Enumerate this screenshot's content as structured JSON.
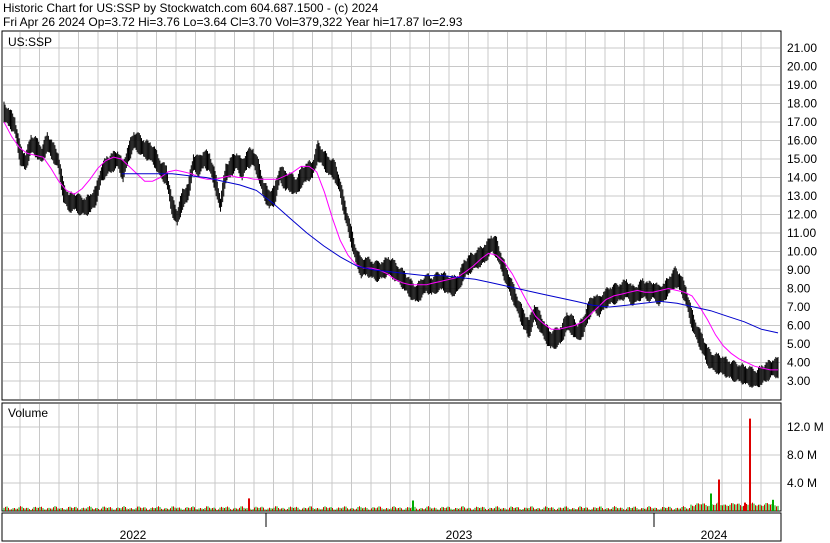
{
  "header": {
    "line1": "Historic Chart for US:SSP by Stockwatch.com 604.687.1500 - (c) 2024",
    "line2": "Fri Apr 26 2024  Op=3.72  Hi=3.76  Lo=3.64  Cl=3.70  Vol=379,322  Year hi=17.87  lo=2.93"
  },
  "chart_data": [
    {
      "type": "line",
      "title": "US:SSP",
      "ylim": [
        2.0,
        22.0
      ],
      "y_ticks": [
        "21.00",
        "20.00",
        "19.00",
        "18.00",
        "17.00",
        "16.00",
        "15.00",
        "14.00",
        "13.00",
        "12.00",
        "11.00",
        "10.00",
        "9.00",
        "8.00",
        "7.00",
        "6.00",
        "5.00",
        "4.00",
        "3.00"
      ],
      "x_labels": [
        "2022",
        "2023",
        "2024"
      ],
      "grid": true,
      "colors": {
        "price": "#000000",
        "ma_short": "#ff00ff",
        "ma_long": "#0000cc"
      },
      "series": [
        {
          "id": "price",
          "values": [
            17.5,
            17.2,
            16.8,
            15.2,
            14.8,
            15.8,
            15.6,
            15.2,
            15.9,
            15.4,
            14.9,
            13.2,
            12.6,
            12.7,
            12.5,
            12.4,
            12.6,
            13.0,
            14.2,
            14.6,
            14.8,
            15.0,
            14.3,
            15.3,
            16.0,
            15.8,
            15.5,
            15.4,
            15.0,
            14.4,
            14.1,
            12.5,
            11.8,
            12.8,
            13.2,
            14.8,
            14.6,
            15.0,
            14.8,
            13.8,
            12.5,
            14.2,
            14.6,
            14.9,
            14.4,
            15.0,
            15.1,
            14.4,
            13.3,
            12.8,
            13.0,
            14.2,
            13.8,
            13.7,
            13.5,
            14.0,
            14.3,
            14.4,
            15.4,
            15.0,
            14.6,
            14.4,
            13.6,
            12.2,
            11.0,
            9.8,
            9.1,
            9.2,
            9.0,
            8.9,
            9.0,
            9.2,
            9.0,
            8.7,
            8.4,
            8.0,
            7.7,
            7.9,
            8.3,
            8.1,
            8.3,
            8.4,
            8.2,
            8.1,
            8.3,
            9.0,
            9.3,
            9.5,
            9.7,
            9.9,
            10.4,
            10.2,
            9.3,
            8.5,
            7.8,
            7.0,
            6.3,
            5.8,
            6.7,
            6.2,
            5.6,
            5.2,
            5.3,
            5.5,
            6.2,
            6.0,
            5.6,
            5.9,
            6.8,
            7.2,
            7.0,
            7.4,
            7.6,
            7.7,
            7.8,
            8.0,
            7.6,
            7.7,
            8.0,
            7.8,
            7.9,
            7.6,
            7.8,
            8.2,
            8.6,
            8.3,
            7.6,
            6.4,
            5.6,
            5.0,
            4.3,
            4.0,
            3.9,
            3.8,
            3.6,
            3.5,
            3.4,
            3.3,
            3.2,
            3.1,
            3.3,
            3.5,
            3.7,
            3.7
          ]
        },
        {
          "id": "ma_short",
          "values": [
            17.0,
            16.2,
            15.6,
            15.3,
            15.2,
            15.1,
            14.5,
            13.8,
            13.3,
            13.1,
            13.4,
            13.9,
            14.5,
            14.9,
            15.1,
            15.0,
            14.6,
            14.2,
            13.8,
            13.8,
            14.0,
            14.3,
            14.4,
            14.3,
            14.2,
            14.0,
            13.9,
            13.9,
            14.0,
            14.1,
            14.0,
            14.0,
            13.9,
            13.9,
            13.9,
            13.9,
            14.1,
            14.3,
            14.6,
            14.6,
            14.3,
            13.2,
            11.8,
            10.6,
            9.8,
            9.3,
            9.1,
            9.1,
            9.0,
            8.8,
            8.5,
            8.3,
            8.2,
            8.2,
            8.2,
            8.3,
            8.4,
            8.5,
            8.6,
            8.9,
            9.2,
            9.6,
            9.9,
            9.8,
            9.4,
            8.8,
            8.0,
            7.2,
            6.5,
            6.1,
            5.8,
            5.8,
            5.9,
            6.0,
            6.2,
            6.6,
            7.0,
            7.4,
            7.6,
            7.7,
            7.8,
            7.9,
            7.8,
            7.8,
            7.9,
            8.0,
            7.9,
            7.8,
            7.6,
            7.0,
            6.3,
            5.5,
            4.9,
            4.5,
            4.2,
            4.0,
            3.8,
            3.7,
            3.6,
            3.6
          ]
        },
        {
          "id": "ma_long",
          "values": [
            null,
            null,
            null,
            null,
            null,
            null,
            null,
            14.2,
            14.2,
            14.2,
            14.2,
            14.1,
            14.0,
            13.8,
            13.6,
            13.3,
            12.6,
            11.8,
            11.0,
            10.3,
            9.7,
            9.2,
            9.0,
            8.9,
            8.8,
            8.7,
            8.7,
            8.6,
            8.5,
            8.3,
            8.1,
            7.9,
            7.7,
            7.5,
            7.3,
            7.1,
            7.0,
            7.1,
            7.2,
            7.3,
            7.2,
            7.0,
            6.8,
            6.5,
            6.2,
            5.8,
            5.6
          ]
        }
      ]
    },
    {
      "type": "bar",
      "title": "Volume",
      "ylim": [
        0,
        14
      ],
      "y_ticks": [
        "12.0 M",
        "8.0 M",
        "4.0 M"
      ],
      "colors": {
        "up": "#00aa00",
        "down": "#dd0000"
      },
      "spikes": [
        {
          "value": 13.2,
          "color": "#dd0000"
        },
        {
          "value": 4.5,
          "color": "#dd0000"
        },
        {
          "value": 2.5,
          "color": "#00aa00"
        },
        {
          "value": 1.8,
          "color": "#dd0000"
        },
        {
          "value": 1.5,
          "color": "#00aa00"
        },
        {
          "value": 1.2,
          "color": "#dd0000"
        },
        {
          "value": 1.6,
          "color": "#00aa00"
        }
      ]
    }
  ]
}
